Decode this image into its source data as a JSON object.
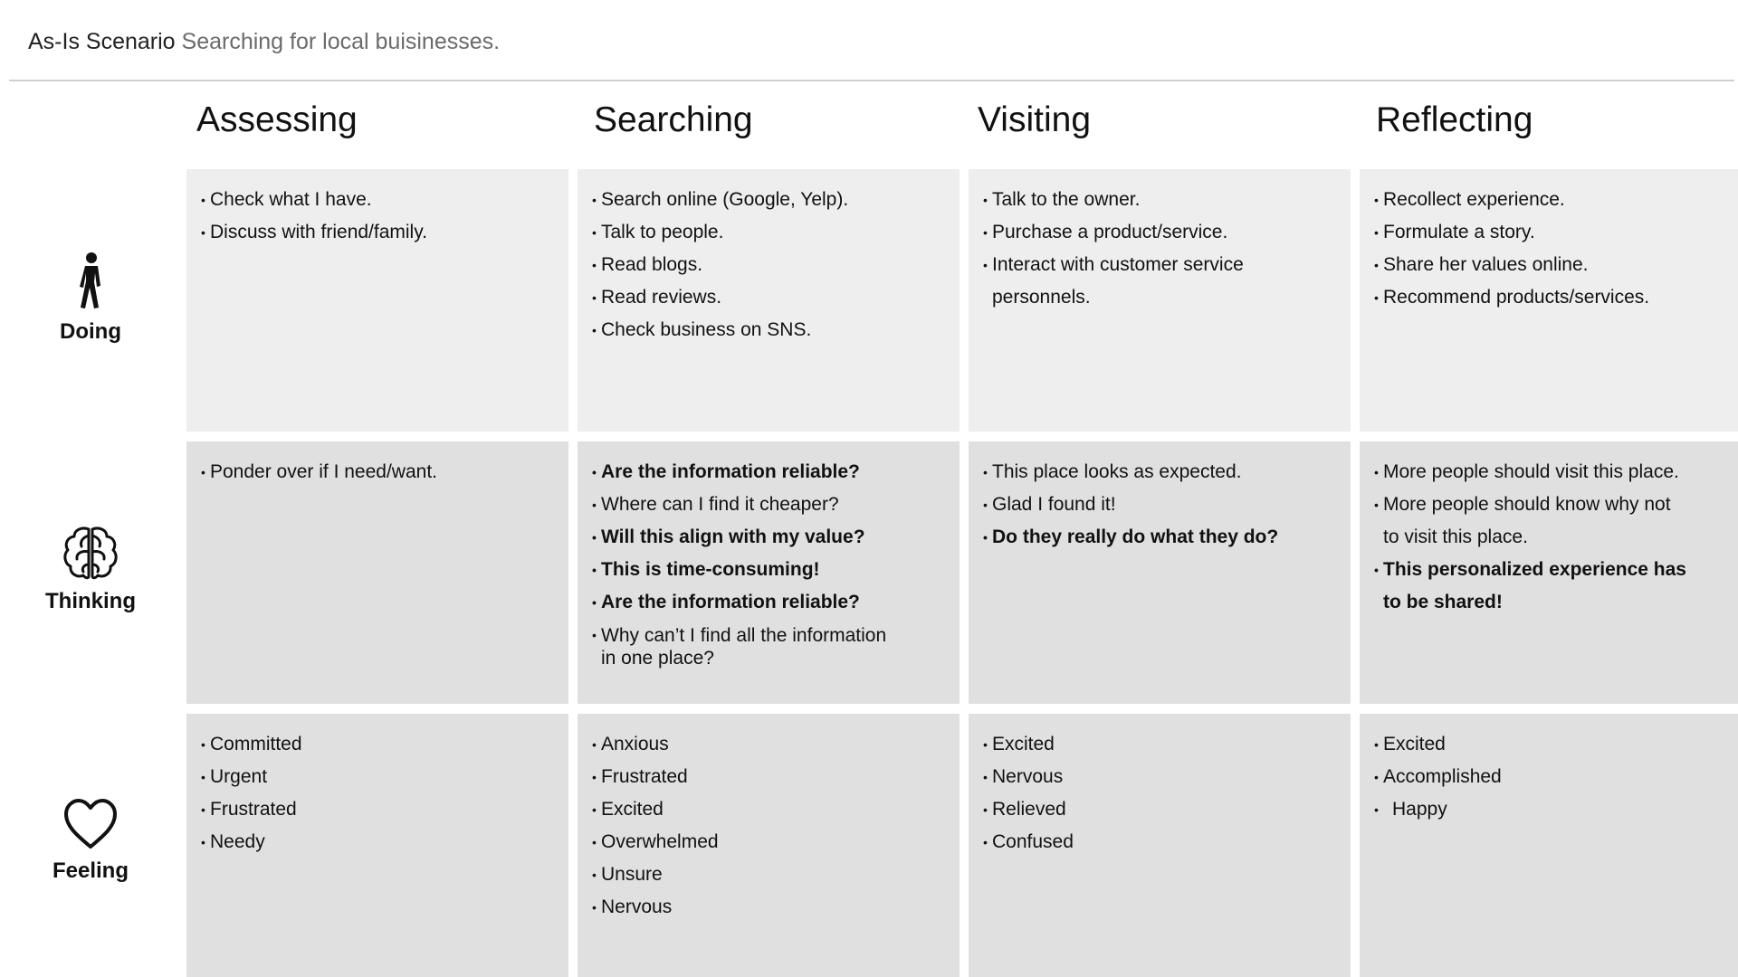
{
  "header": {
    "title": "As-Is Scenario",
    "subtitle": "Searching for local buisinesses."
  },
  "phases": [
    "Assessing",
    "Searching",
    "Visiting",
    "Reflecting"
  ],
  "rows": [
    {
      "label": "Doing",
      "icon": "walking-person-icon"
    },
    {
      "label": "Thinking",
      "icon": "brain-icon"
    },
    {
      "label": "Feeling",
      "icon": "heart-icon"
    }
  ],
  "cells": {
    "doing": [
      [
        "Check what I have.",
        "Discuss with friend/family."
      ],
      [
        "Search online (Google, Yelp).",
        "Talk to people.",
        "Read blogs.",
        "Read reviews.",
        "Check business on SNS."
      ],
      [
        "Talk to the owner.",
        "Purchase a product/service.",
        "Interact with customer service personnels."
      ],
      [
        "Recollect experience.",
        "Formulate a story.",
        "Share her values online.",
        "Recommend products/services."
      ]
    ],
    "thinking": [
      [
        "Ponder over if I need/want."
      ],
      [
        "Are the information reliable?",
        "Where can I find it cheaper?",
        "Will this align with my value?",
        "This is time-consuming!",
        "Are the information reliable?",
        "Why can’t I find all the information in one place?"
      ],
      [
        "This place looks as expected.",
        "Glad I found it!",
        "Do they really do what they do?"
      ],
      [
        "More people should visit this place.",
        "More people should know why not to visit this place.",
        "This personalized experience has to be shared!"
      ]
    ],
    "feeling": [
      [
        "Committed",
        "Urgent",
        "Frustrated",
        "Needy"
      ],
      [
        "Anxious",
        "Frustrated",
        "Excited",
        "Overwhelmed",
        "Unsure",
        "Nervous"
      ],
      [
        "Excited",
        "Nervous",
        "Relieved",
        "Confused"
      ],
      [
        "Excited",
        "Accomplished",
        "Happy"
      ]
    ]
  }
}
